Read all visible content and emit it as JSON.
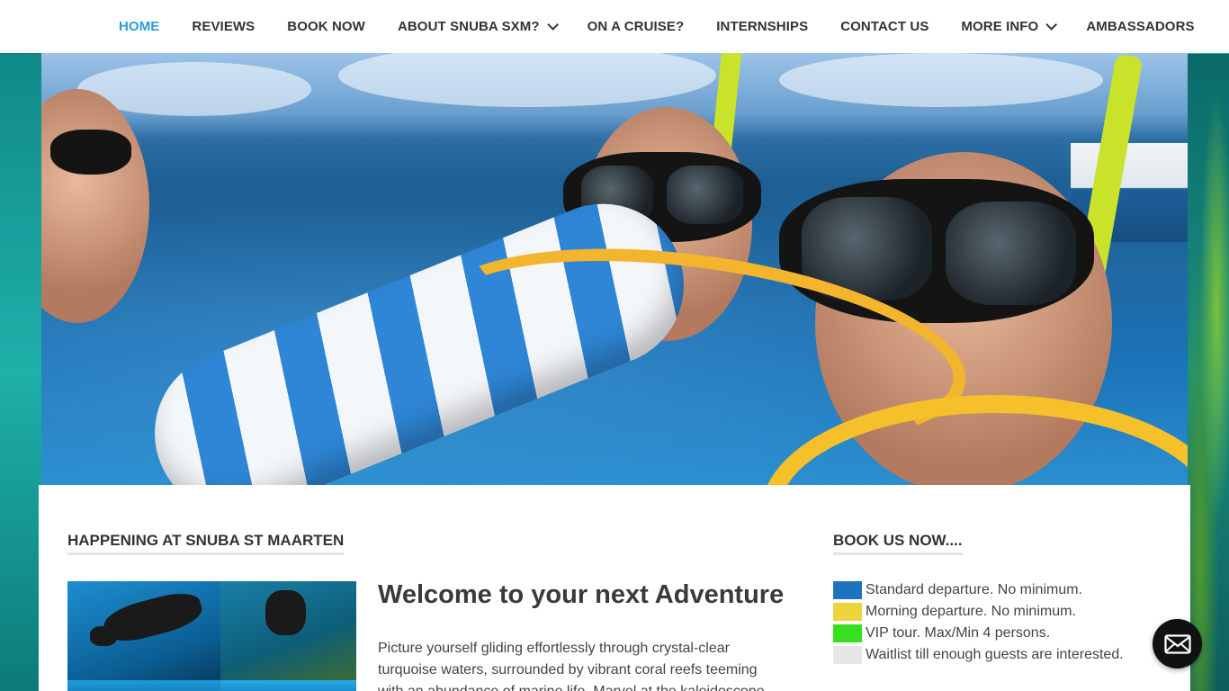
{
  "nav": {
    "items": [
      {
        "label": "HOME",
        "active": true,
        "dropdown": false
      },
      {
        "label": "REVIEWS",
        "active": false,
        "dropdown": false
      },
      {
        "label": "BOOK NOW",
        "active": false,
        "dropdown": false
      },
      {
        "label": "ABOUT SNUBA SXM?",
        "active": false,
        "dropdown": true
      },
      {
        "label": "ON A CRUISE?",
        "active": false,
        "dropdown": false
      },
      {
        "label": "INTERNSHIPS",
        "active": false,
        "dropdown": false
      },
      {
        "label": "CONTACT US",
        "active": false,
        "dropdown": false
      },
      {
        "label": "MORE INFO",
        "active": false,
        "dropdown": true
      },
      {
        "label": "AMBASSADORS",
        "active": false,
        "dropdown": false
      }
    ],
    "active_color": "#2a9fd6"
  },
  "hero": {
    "image": "snuba-divers-masks-snorkels-float-photo"
  },
  "main": {
    "happening_heading": "HAPPENING AT SNUBA ST MAARTEN",
    "welcome_title": "Welcome to your next Adventure",
    "welcome_text": "Picture yourself gliding effortlessly through crystal-clear turquoise waters, surrounded by vibrant coral reefs teeming with an abundance of marine life. Marvel at the kaleidoscope"
  },
  "sidebar": {
    "heading": "BOOK US NOW....",
    "legend": [
      {
        "label": "Standard departure. No minimum.",
        "color": "#1e73be"
      },
      {
        "label": "Morning departure. No minimum.",
        "color": "#eed33a"
      },
      {
        "label": "VIP tour. Max/Min 4 persons.",
        "color": "#36e01f"
      },
      {
        "label": "Waitlist till enough guests are interested.",
        "color": "#e6e6e6"
      }
    ]
  },
  "contact_fab": {
    "icon": "envelope-icon"
  }
}
